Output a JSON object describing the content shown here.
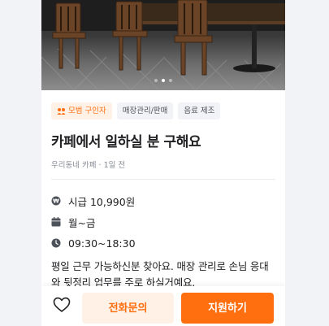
{
  "hero": {
    "alt": "카페 매장 사진",
    "slide_count": 3,
    "active_slide": 2
  },
  "tags": [
    {
      "label": "모범 구인자",
      "icon": "medal-icon",
      "accent": true
    },
    {
      "label": "매장관리/판매"
    },
    {
      "label": "음료 제조"
    }
  ],
  "post": {
    "title": "카페에서 일하실 분 구해요",
    "store": "우리동네 카페",
    "separator": "·",
    "posted": "1일 전"
  },
  "info": {
    "wage": "시급 10,990원",
    "days": "월~금",
    "hours": "09:30~18:30"
  },
  "description": "평일 근무 가능하신분 찾아요. 매장 관리로 손님 응대와 뒷정리 업무를 주로 하실거예요.",
  "actions": {
    "call_label": "전화문의",
    "apply_label": "지원하기"
  },
  "colors": {
    "brand": "#ff6f0f",
    "brand_light": "#fff1e6",
    "muted": "#868b94"
  }
}
